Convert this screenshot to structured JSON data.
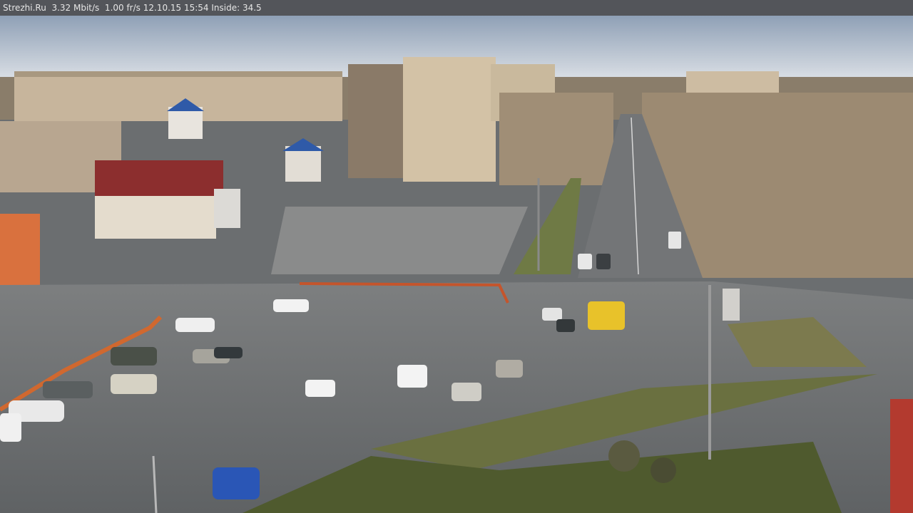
{
  "overlay": {
    "text": "Strezhi.Ru  3.32 Mbit/s  1.00 fr/s 12.10.15 15:54 Inside: 34.5"
  },
  "scene": {
    "description_free": true
  }
}
